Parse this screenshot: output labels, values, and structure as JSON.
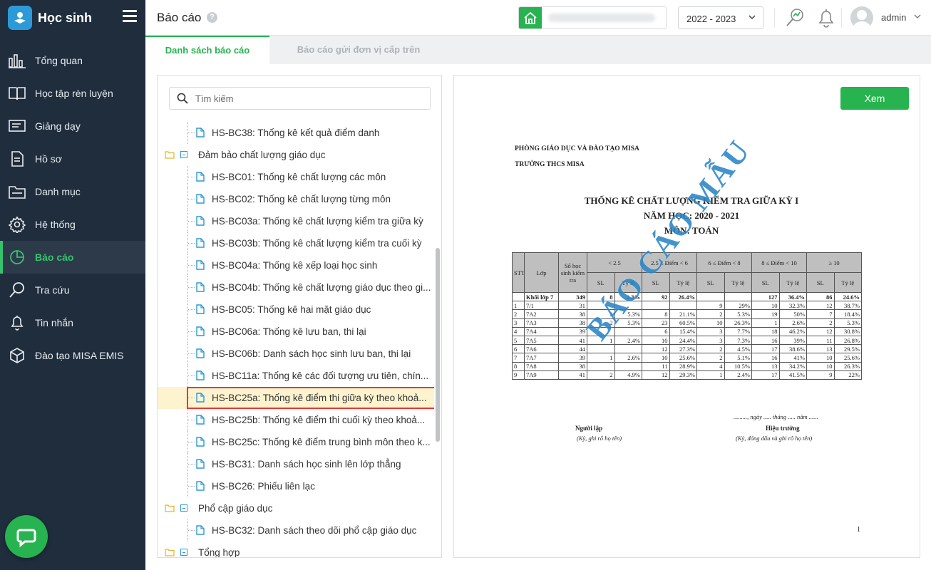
{
  "sidebar": {
    "app_title": "Học sinh",
    "items": [
      {
        "label": "Tổng quan",
        "icon": "chart-bars-icon"
      },
      {
        "label": "Học tập rèn luyện",
        "icon": "book-icon"
      },
      {
        "label": "Giảng dạy",
        "icon": "board-icon"
      },
      {
        "label": "Hồ sơ",
        "icon": "document-icon"
      },
      {
        "label": "Danh mục",
        "icon": "folder-icon"
      },
      {
        "label": "Hệ thống",
        "icon": "gear-icon"
      },
      {
        "label": "Báo cáo",
        "icon": "pie-chart-icon",
        "active": true
      },
      {
        "label": "Tra cứu",
        "icon": "search-icon"
      },
      {
        "label": "Tin nhắn",
        "icon": "bell-icon"
      },
      {
        "label": "Đào tạo MISA EMIS",
        "icon": "cube-icon"
      }
    ]
  },
  "header": {
    "title": "Báo cáo",
    "help": "?",
    "school_year": "2022 - 2023",
    "username": "admin"
  },
  "tabs": [
    "Danh sách báo cáo",
    "Báo cáo gửi đơn vị cấp trên"
  ],
  "search": {
    "placeholder": "Tìm kiếm"
  },
  "tree": [
    {
      "type": "leaf",
      "label": "HS-BC38: Thống kê kết quả điểm danh"
    },
    {
      "type": "folder",
      "label": "Đảm bảo chất lượng giáo dục"
    },
    {
      "type": "leaf",
      "label": "HS-BC01: Thống kê chất lượng các môn"
    },
    {
      "type": "leaf",
      "label": "HS-BC02: Thống kê chất lượng từng môn"
    },
    {
      "type": "leaf",
      "label": "HS-BC03a: Thống kê chất lượng kiểm tra giữa kỳ"
    },
    {
      "type": "leaf",
      "label": "HS-BC03b: Thống kê chất lượng kiểm tra cuối kỳ"
    },
    {
      "type": "leaf",
      "label": "HS-BC04a: Thống kê xếp loại học sinh"
    },
    {
      "type": "leaf",
      "label": "HS-BC04b: Thống kê chất lượng giáo dục theo gi..."
    },
    {
      "type": "leaf",
      "label": "HS-BC05: Thống kê hai mặt giáo dục"
    },
    {
      "type": "leaf",
      "label": "HS-BC06a: Thống kê lưu ban, thi lại"
    },
    {
      "type": "leaf",
      "label": "HS-BC06b: Danh sách học sinh lưu ban, thi lại"
    },
    {
      "type": "leaf",
      "label": "HS-BC11a: Thống kê các đối tượng ưu tiên, chín..."
    },
    {
      "type": "leaf",
      "label": "HS-BC25a: Thống kê điểm thi giữa kỳ theo khoả...",
      "selected": true
    },
    {
      "type": "leaf",
      "label": "HS-BC25b: Thống kê điểm thi cuối kỳ theo khoả..."
    },
    {
      "type": "leaf",
      "label": "HS-BC25c: Thống kê điểm trung bình môn theo k..."
    },
    {
      "type": "leaf",
      "label": "HS-BC31: Danh sách học sinh lên lớp thẳng"
    },
    {
      "type": "leaf",
      "label": "HS-BC26: Phiếu liên lạc"
    },
    {
      "type": "folder",
      "label": "Phổ cập giáo dục"
    },
    {
      "type": "leaf",
      "label": "HS-BC32: Danh sách theo dõi phổ cập giáo dục"
    },
    {
      "type": "folder",
      "label": "Tổng hợp"
    }
  ],
  "preview": {
    "view_button": "Xem",
    "org_line1": "PHÒNG GIÁO DỤC VÀ ĐÀO TẠO MISA",
    "org_line2": "TRƯỜNG THCS MISA",
    "title1": "THỐNG KÊ CHẤT LƯỢNG KIỂM TRA GIỮA KỲ I",
    "title2": "NĂM HỌC: 2020 - 2021",
    "title3": "MÔN: TOÁN",
    "headers": {
      "stt": "STT",
      "class": "Lớp",
      "count": "Số học sinh kiểm tra",
      "groups": [
        "< 2.5",
        "2.5 ≤ Điểm < 6",
        "6 ≤ Điểm < 8",
        "8 ≤ Điểm < 10",
        "≥ 10"
      ],
      "sl": "SL",
      "rate": "Tỷ lệ"
    },
    "rows": [
      [
        "",
        "Khối lớp 7",
        "349",
        "8",
        "2.3%",
        "92",
        "26.4%",
        "",
        "",
        "127",
        "36.4%",
        "86",
        "24.6%"
      ],
      [
        "1",
        "7/1",
        "31",
        "",
        "",
        "",
        "",
        "9",
        "29%",
        "10",
        "32.3%",
        "12",
        "38.7%"
      ],
      [
        "2",
        "7A2",
        "38",
        "2",
        "5.3%",
        "8",
        "21.1%",
        "2",
        "5.3%",
        "19",
        "50%",
        "7",
        "18.4%"
      ],
      [
        "3",
        "7A3",
        "38",
        "2",
        "5.3%",
        "23",
        "60.5%",
        "10",
        "26.3%",
        "1",
        "2.6%",
        "2",
        "5.3%"
      ],
      [
        "4",
        "7A4",
        "39",
        "",
        "",
        "6",
        "15.4%",
        "3",
        "7.7%",
        "18",
        "46.2%",
        "12",
        "30.8%"
      ],
      [
        "5",
        "7A5",
        "41",
        "1",
        "2.4%",
        "10",
        "24.4%",
        "3",
        "7.3%",
        "16",
        "39%",
        "11",
        "26.8%"
      ],
      [
        "6",
        "7A6",
        "44",
        "",
        "",
        "12",
        "27.3%",
        "2",
        "4.5%",
        "17",
        "38.6%",
        "13",
        "29.5%"
      ],
      [
        "7",
        "7A7",
        "39",
        "1",
        "2.6%",
        "10",
        "25.6%",
        "2",
        "5.1%",
        "16",
        "41%",
        "10",
        "25.6%"
      ],
      [
        "8",
        "7A8",
        "38",
        "",
        "",
        "11",
        "28.9%",
        "4",
        "10.5%",
        "13",
        "34.2%",
        "10",
        "26.3%"
      ],
      [
        "9",
        "7A9",
        "41",
        "2",
        "4.9%",
        "12",
        "29.3%",
        "1",
        "2.4%",
        "17",
        "41.5%",
        "9",
        "22%"
      ]
    ],
    "sign_date": "........., ngày ..... tháng ..... năm ......",
    "sign_left": "Người lập",
    "sign_left_note": "(Ký, ghi rõ họ tên)",
    "sign_right": "Hiệu trưởng",
    "sign_right_note": "(Ký, đóng dấu và ghi rõ họ tên)",
    "page_number": "1",
    "watermark": "BÁO CÁO MẪU"
  },
  "colors": {
    "sidebar_bg": "#1f2d3d",
    "accent": "#27b34f",
    "active_text": "#35c46d",
    "selection_bg": "#fdf3cf",
    "selection_border": "#e53935",
    "watermark": "#2a86c6"
  }
}
